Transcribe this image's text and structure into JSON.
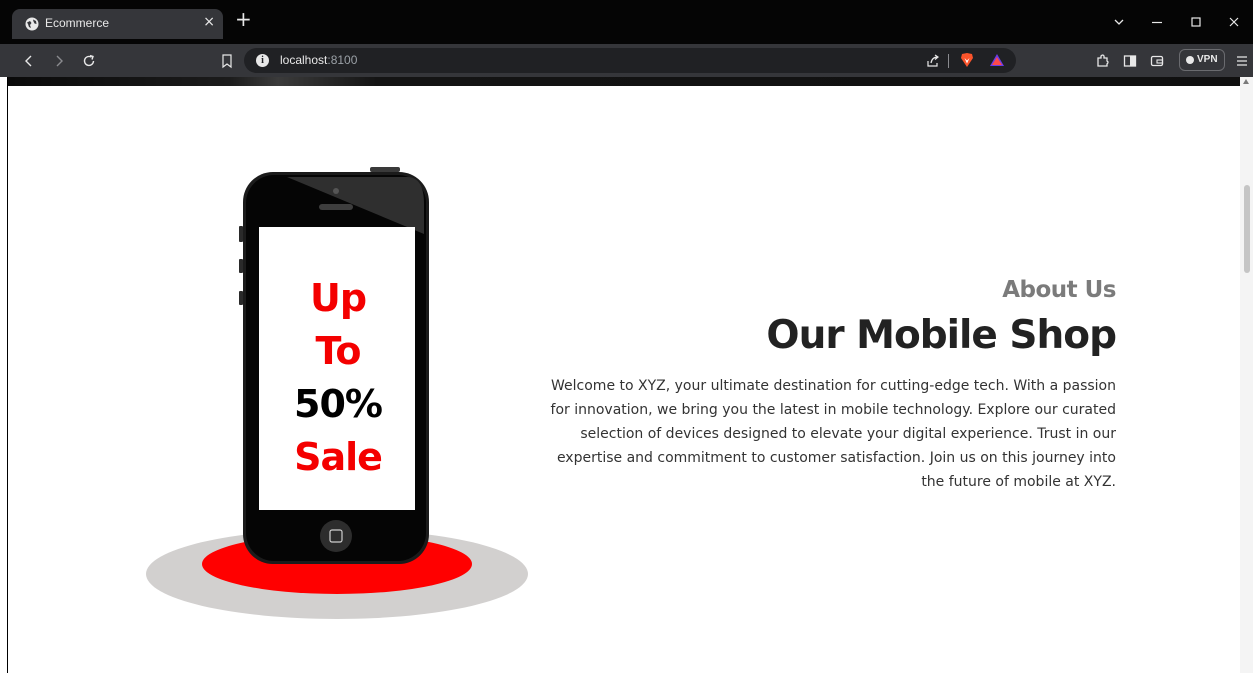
{
  "browser": {
    "tab": {
      "title": "Ecommerce",
      "close": "×"
    },
    "new_tab": "+",
    "address": {
      "host": "localhost",
      "port": ":8100",
      "info": "i"
    },
    "vpn_label": "VPN"
  },
  "about": {
    "subtitle": "About Us",
    "title": "Our Mobile Shop",
    "description": "Welcome to XYZ, your ultimate destination for cutting-edge tech. With a passion for innovation, we bring you the latest in mobile technology. Explore our curated selection of devices designed to elevate your digital experience. Trust in our expertise and commitment to customer satisfaction. Join us on this journey into the future of mobile at XYZ."
  },
  "promo": {
    "line1": "Up",
    "line2": "To",
    "line3": "50%",
    "line4": "Sale"
  },
  "colors": {
    "promo_red": "#f40000",
    "base_red": "#ff0000",
    "heading": "#222222",
    "subheading": "#7b7b7b"
  }
}
